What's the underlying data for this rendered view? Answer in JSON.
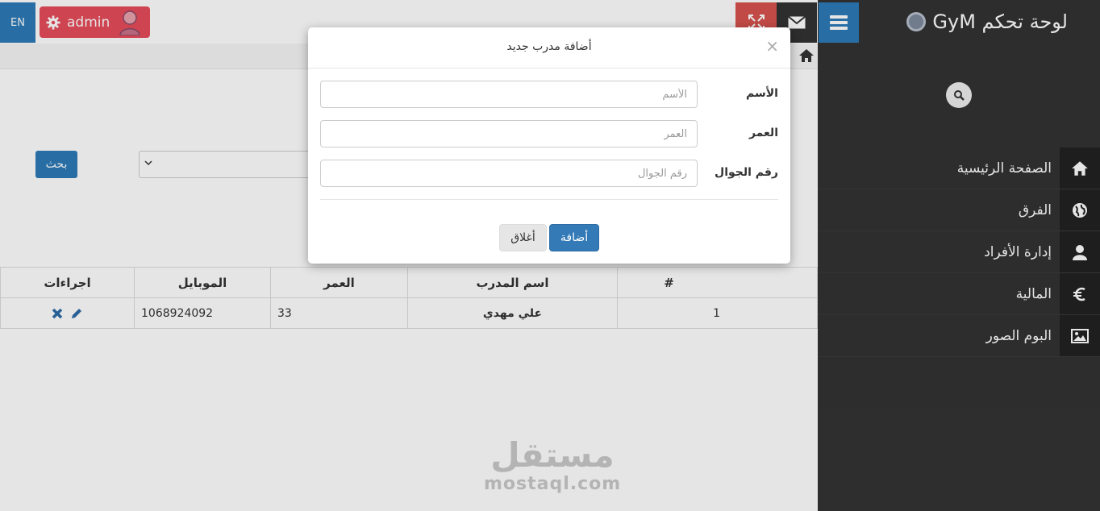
{
  "header": {
    "brand": "لوحة تحكم GyM",
    "language_button": "EN",
    "user_button": "admin"
  },
  "sidebar": {
    "items": [
      {
        "label": "الصفحة الرئيسية",
        "icon": "home-icon"
      },
      {
        "label": "الفرق",
        "icon": "globe-icon"
      },
      {
        "label": "إدارة الأفراد",
        "icon": "user-icon"
      },
      {
        "label": "المالية",
        "icon": "euro-icon"
      },
      {
        "label": "البوم الصور",
        "icon": "picture-icon"
      }
    ]
  },
  "main": {
    "search_button": "بحث",
    "table": {
      "headers": [
        "#",
        "اسم المدرب",
        "العمر",
        "الموبايل",
        "اجراءات"
      ],
      "rows": [
        {
          "num": "1",
          "name": "علي مهدي",
          "age": "33",
          "mobile": "1068924092"
        }
      ]
    },
    "watermark": {
      "arabic": "مستقل",
      "latin": "mostaql.com"
    }
  },
  "modal": {
    "title": "أضافة مدرب جديد",
    "close": "×",
    "fields": [
      {
        "label": "الأسم",
        "placeholder": "الأسم",
        "value": ""
      },
      {
        "label": "العمر",
        "placeholder": "العمر",
        "value": ""
      },
      {
        "label": "رقم الجوال",
        "placeholder": "رقم الجوال",
        "value": ""
      }
    ],
    "submit_label": "أضافة",
    "close_label": "أغلاق"
  },
  "colors": {
    "sidebar_bg": "#333333",
    "accent_blue": "#2d7bb8",
    "admin_red": "#e74c5b",
    "primary_button": "#337ab7"
  }
}
